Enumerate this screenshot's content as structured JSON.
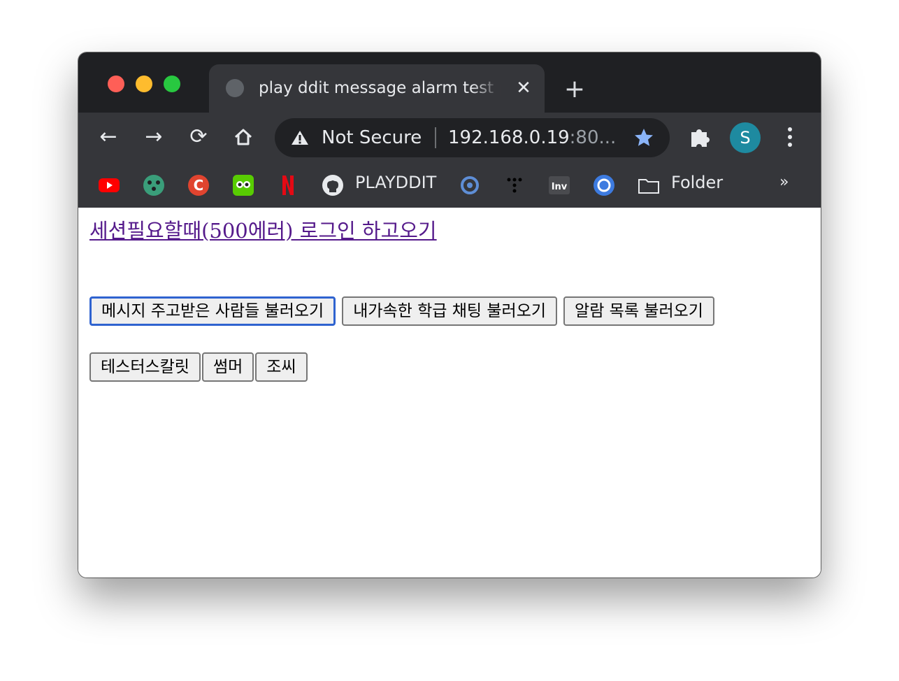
{
  "browser": {
    "tab": {
      "title": "play ddit message alarm test page"
    },
    "toolbar": {
      "security_label": "Not Secure",
      "url_host": "192.168.0.19",
      "url_port": ":80..."
    },
    "profile": {
      "initial": "S",
      "color": "#1e8aa0"
    },
    "bookmarks": {
      "playddit_label": "PLAYDDIT",
      "folder_label": "Folder",
      "more_label": "»"
    }
  },
  "page": {
    "session_link": "세션필요할때(500에러) 로그인 하고오기",
    "buttons_row1": [
      "메시지 주고받은 사람들 불러오기",
      "내가속한 학급 채팅 불러오기",
      "알람 목록 불러오기"
    ],
    "buttons_row2": [
      "테스터스칼릿",
      "썸머",
      "조씨"
    ]
  },
  "colors": {
    "link_visited": "#551a8b",
    "focus_ring": "#2f63d0",
    "star": "#8ab4f8"
  }
}
